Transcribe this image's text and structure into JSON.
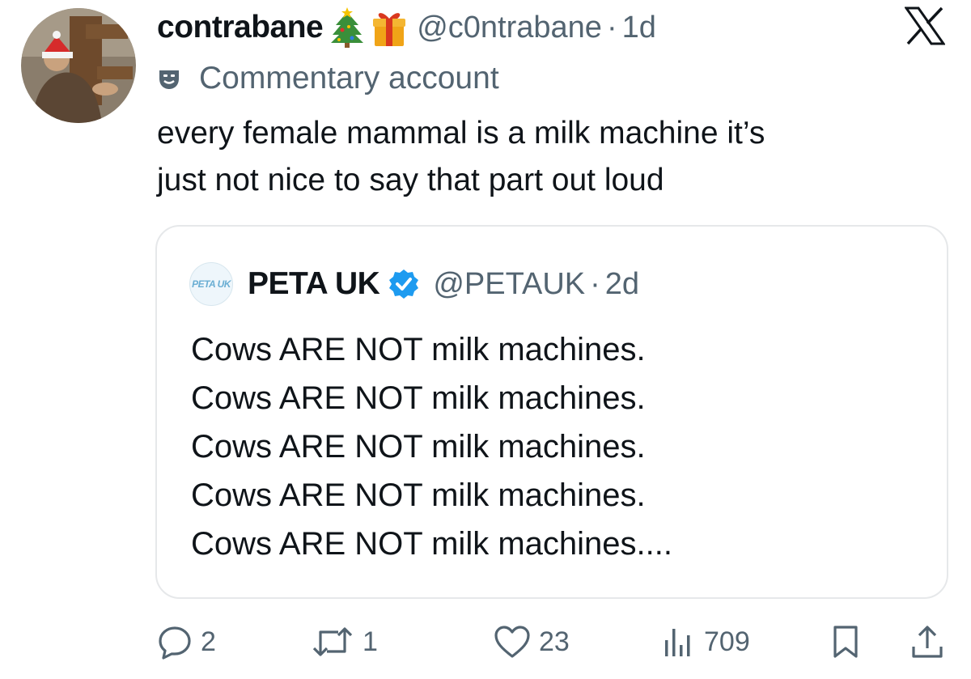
{
  "tweet": {
    "display_name": "contrabane",
    "emojis": [
      "christmas-tree-icon",
      "gift-icon"
    ],
    "handle": "@c0ntrabane",
    "separator": "·",
    "time": "1d",
    "label": "Commentary account",
    "text": "every female mammal is a milk machine it’s\njust not nice to say that part out loud"
  },
  "quoted": {
    "avatar_text": "PETA UK",
    "display_name": "PETA UK",
    "verified": true,
    "handle": "@PETAUK",
    "separator": "·",
    "time": "2d",
    "lines": [
      "Cows ARE NOT milk machines.",
      "Cows ARE NOT milk machines.",
      "Cows ARE NOT milk machines.",
      "Cows ARE NOT milk machines.",
      "Cows ARE NOT milk machines...."
    ]
  },
  "actions": {
    "replies": "2",
    "reposts": "1",
    "likes": "23",
    "views": "709"
  },
  "colors": {
    "text": "#0f1419",
    "secondary": "#536471",
    "border": "#e6e8ea",
    "verified": "#1d9bf0"
  }
}
